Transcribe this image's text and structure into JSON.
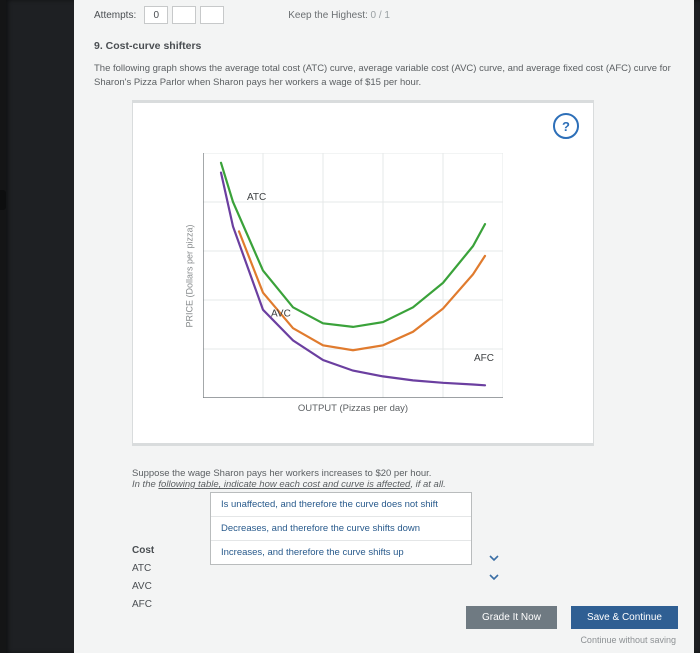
{
  "attempts": {
    "label": "Attempts:",
    "boxes": [
      "0",
      "",
      ""
    ],
    "keep_label": "Keep the Highest:",
    "keep_value": "0 / 1"
  },
  "question": {
    "number_title": "9. Cost-curve shifters",
    "intro": "The following graph shows the average total cost (ATC) curve, average variable cost (AVC) curve, and average fixed cost (AFC) curve for Sharon's Pizza Parlor when Sharon pays her workers a wage of $15 per hour."
  },
  "help_icon_glyph": "?",
  "chart_data": {
    "type": "line",
    "title": "",
    "xlabel": "OUTPUT (Pizzas per day)",
    "ylabel": "PRICE (Dollars per pizza)",
    "xlim": [
      0,
      10
    ],
    "ylim": [
      0,
      10
    ],
    "series": [
      {
        "name": "ATC",
        "color": "#3aa23a",
        "x": [
          0.6,
          1,
          2,
          3,
          4,
          5,
          6,
          7,
          8,
          9,
          9.4
        ],
        "y": [
          9.6,
          8.0,
          5.2,
          3.7,
          3.05,
          2.9,
          3.1,
          3.7,
          4.7,
          6.2,
          7.1
        ]
      },
      {
        "name": "AVC",
        "color": "#e07b2e",
        "x": [
          1.2,
          2,
          3,
          4,
          5,
          6,
          7,
          8,
          9,
          9.4
        ],
        "y": [
          6.8,
          4.3,
          2.85,
          2.15,
          1.95,
          2.15,
          2.7,
          3.65,
          5.05,
          5.8
        ]
      },
      {
        "name": "AFC",
        "color": "#6b3fa0",
        "x": [
          0.6,
          1,
          2,
          3,
          4,
          5,
          6,
          7,
          8,
          9,
          9.4
        ],
        "y": [
          9.2,
          7.0,
          3.6,
          2.35,
          1.55,
          1.12,
          0.88,
          0.72,
          0.62,
          0.55,
          0.52
        ]
      }
    ],
    "series_labels": {
      "ATC": "ATC",
      "AVC": "AVC",
      "AFC": "AFC"
    }
  },
  "followup": {
    "line1": "Suppose the wage Sharon pays her workers increases to $20 per hour.",
    "line2_prefix": "In the ",
    "line2_underlined": "following table, indicate how each cost and curve is affected",
    "line2_suffix": ", if at all."
  },
  "dropdown_options": [
    "Is unaffected, and therefore the curve does not shift",
    "Decreases, and therefore the curve shifts down",
    "Increases, and therefore the curve shifts up"
  ],
  "table": {
    "header": "Cost",
    "rows": [
      "ATC",
      "AVC",
      "AFC"
    ]
  },
  "buttons": {
    "grade": "Grade It Now",
    "save": "Save & Continue",
    "continue_link": "Continue without saving"
  }
}
